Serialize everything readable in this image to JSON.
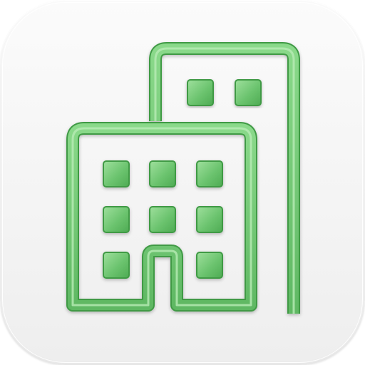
{
  "app_icon": {
    "icon_name": "office-building-icon",
    "style": "rounded-square app icon, light gray tile with green outlined buildings",
    "colors": {
      "tile_light": "#fbfbfb",
      "tile_dark": "#eeeeee",
      "accent_green": "#6cc46f",
      "accent_green_dark": "#3f9a45",
      "accent_green_light": "#a6e0a4"
    }
  }
}
